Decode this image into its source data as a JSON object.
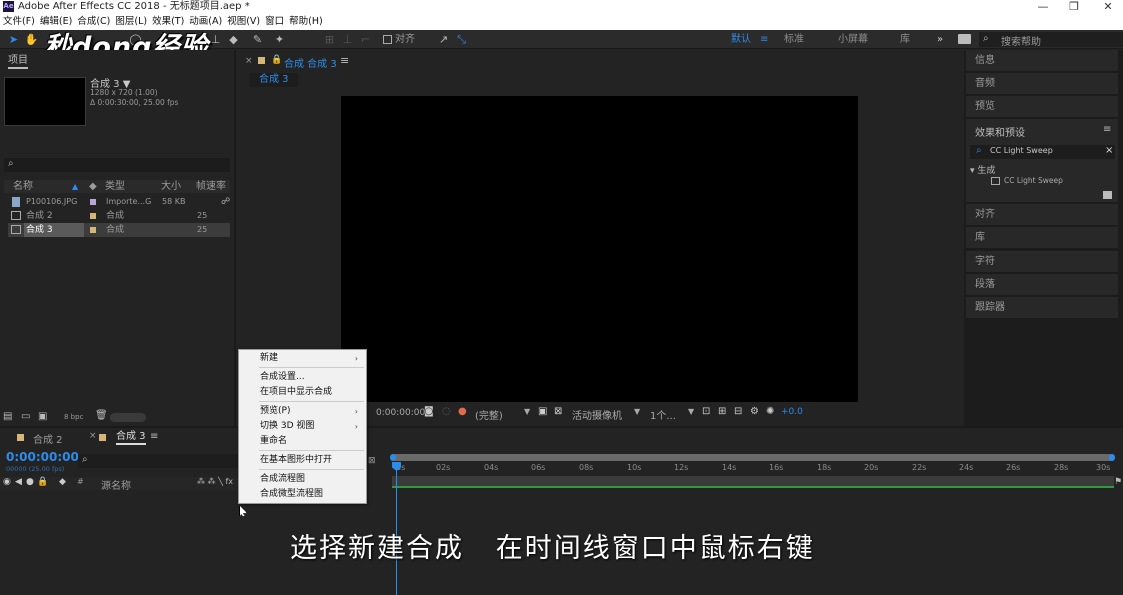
{
  "window": {
    "title": "Adobe After Effects CC 2018 - 无标题项目.aep *",
    "logo_text": "Ae",
    "minimize": "—",
    "maximize": "❐",
    "close": "✕"
  },
  "menu": [
    "文件(F)",
    "编辑(E)",
    "合成(C)",
    "图层(L)",
    "效果(T)",
    "动画(A)",
    "视图(V)",
    "窗口",
    "帮助(H)"
  ],
  "toolbar": {
    "align_label": "对齐",
    "workspaces": [
      "默认",
      "标准",
      "小屏幕",
      "库"
    ],
    "more": "»",
    "search_placeholder": "搜索帮助"
  },
  "watermark": "秒dong经验",
  "project": {
    "tab_label": "项目",
    "comp_name": "合成 3 ▼",
    "comp_info_1": "1280 x 720 (1.00)",
    "comp_info_2": "Δ 0:00:30:00, 25.00 fps",
    "columns": [
      "名称",
      "类型",
      "大小",
      "帧速率"
    ],
    "items": [
      {
        "name": "P100106.JPG",
        "type": "Importe...G",
        "size": "58 KB",
        "fps": ""
      },
      {
        "name": "合成 2",
        "type": "合成",
        "size": "",
        "fps": "25"
      },
      {
        "name": "合成 3",
        "type": "合成",
        "size": "",
        "fps": "25"
      }
    ],
    "bpc": "8 bpc"
  },
  "composition": {
    "panel_tab": "合成 合成 3",
    "sub_tab": "合成 3",
    "time": "0:00:00:00",
    "quality": "(完整)",
    "camera": "活动摄像机",
    "views": "1个...",
    "offset": "+0.0"
  },
  "right_panel": {
    "items_top": [
      "信息",
      "音频",
      "预览"
    ],
    "effects_title": "效果和预设",
    "effects_search": "CC Light Sweep",
    "category": "▾ 生成",
    "effect_item": "CC Light Sweep",
    "items_bottom": [
      "对齐",
      "库",
      "字符",
      "段落",
      "跟踪器"
    ]
  },
  "context_menu": [
    {
      "label": "新建",
      "submenu": true
    },
    {
      "label": "合成设置...",
      "submenu": false
    },
    {
      "label": "在项目中显示合成",
      "submenu": false
    },
    {
      "label": "预览(P)",
      "submenu": true
    },
    {
      "label": "切换 3D 视图",
      "submenu": true
    },
    {
      "label": "重命名",
      "submenu": false
    },
    {
      "label": "在基本图形中打开",
      "submenu": false
    },
    {
      "label": "合成流程图",
      "submenu": false
    },
    {
      "label": "合成微型流程图",
      "submenu": false
    }
  ],
  "timeline": {
    "tabs": [
      "合成 2",
      "合成 3"
    ],
    "time": "0:00:00:00",
    "time_sub": "00000 (25.00 fps)",
    "layer_header": "源名称",
    "ruler": [
      "0s",
      "02s",
      "04s",
      "06s",
      "08s",
      "10s",
      "12s",
      "14s",
      "16s",
      "18s",
      "20s",
      "22s",
      "24s",
      "26s",
      "28s",
      "30s"
    ]
  },
  "subtitle": "选择新建合成   在时间线窗口中鼠标右键",
  "colors": {
    "accent": "#2d8ceb",
    "timecode": "#2d8ceb",
    "panel": "#232323",
    "menu_bg": "#f1f1f1"
  }
}
